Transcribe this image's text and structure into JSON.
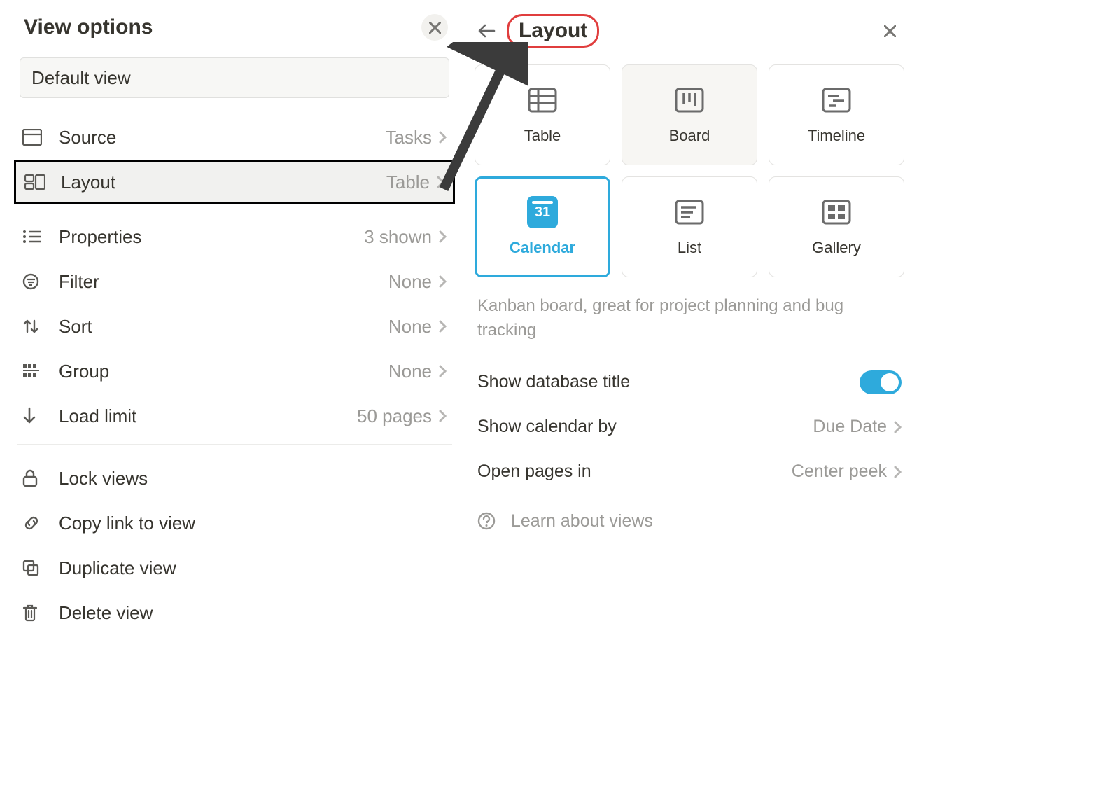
{
  "view_options": {
    "title": "View options",
    "view_name": "Default view",
    "rows": {
      "source": {
        "label": "Source",
        "value": "Tasks"
      },
      "layout": {
        "label": "Layout",
        "value": "Table"
      },
      "properties": {
        "label": "Properties",
        "value": "3 shown"
      },
      "filter": {
        "label": "Filter",
        "value": "None"
      },
      "sort": {
        "label": "Sort",
        "value": "None"
      },
      "group": {
        "label": "Group",
        "value": "None"
      },
      "load_limit": {
        "label": "Load limit",
        "value": "50 pages"
      }
    },
    "actions": {
      "lock": "Lock views",
      "copy_link": "Copy link to view",
      "duplicate": "Duplicate view",
      "delete": "Delete view"
    }
  },
  "layout_panel": {
    "title": "Layout",
    "options": {
      "table": "Table",
      "board": "Board",
      "timeline": "Timeline",
      "calendar": "Calendar",
      "list": "List",
      "gallery": "Gallery"
    },
    "calendar_badge": "31",
    "description": "Kanban board, great for project planning and bug tracking",
    "settings": {
      "show_db_title": {
        "label": "Show database title",
        "enabled": true
      },
      "show_calendar_by": {
        "label": "Show calendar by",
        "value": "Due Date"
      },
      "open_pages_in": {
        "label": "Open pages in",
        "value": "Center peek"
      }
    },
    "learn_link": "Learn about views"
  }
}
